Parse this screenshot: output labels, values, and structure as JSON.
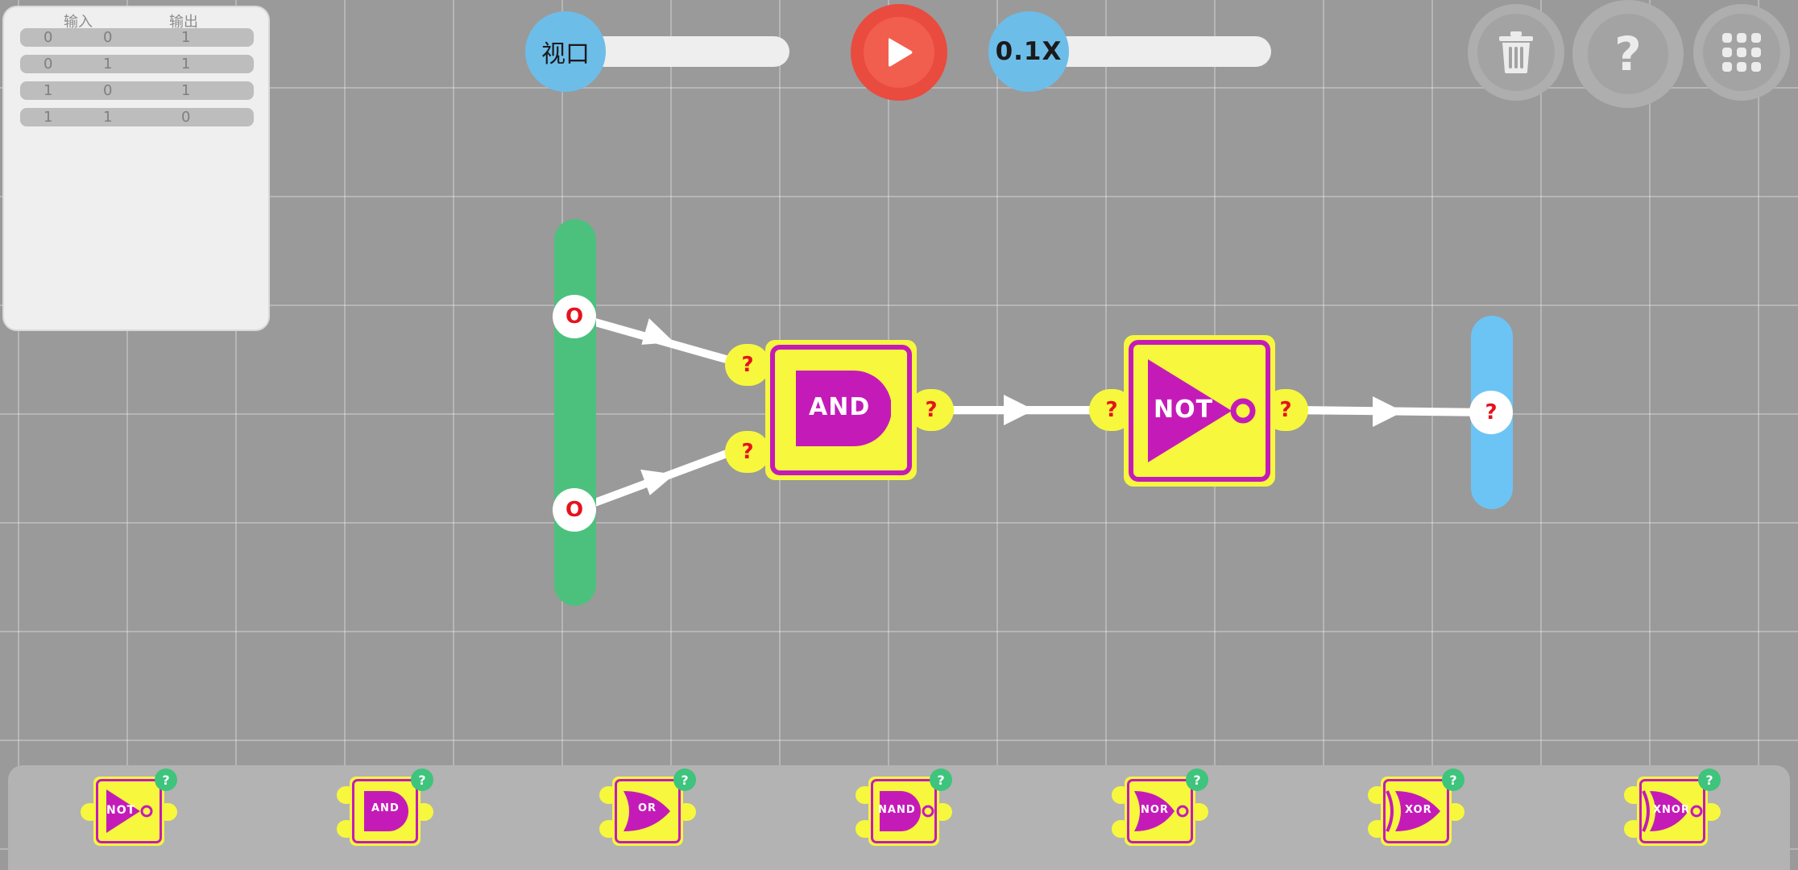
{
  "truth_table": {
    "headers": {
      "input": "输入",
      "output": "输出"
    },
    "rows": [
      [
        "0",
        "0",
        "1"
      ],
      [
        "0",
        "1",
        "1"
      ],
      [
        "1",
        "0",
        "1"
      ],
      [
        "1",
        "1",
        "0"
      ]
    ]
  },
  "controls": {
    "viewport_label": "视口",
    "speed_label": "0.1X",
    "help_label": "?"
  },
  "circuit": {
    "input_pins": [
      "O",
      "O"
    ],
    "and_ports": {
      "in1": "?",
      "in2": "?",
      "out": "?"
    },
    "and_label": "AND",
    "not_ports": {
      "in": "?",
      "out": "?"
    },
    "not_label": "NOT",
    "output_pin": "?"
  },
  "palette": {
    "badge": "?",
    "items": [
      "NOT",
      "AND",
      "OR",
      "NAND",
      "NOR",
      "XOR",
      "XNOR"
    ]
  },
  "colors": {
    "background": "#9a9a9a",
    "gate_yellow": "#f7f73e",
    "gate_magenta": "#c41bb8",
    "input_rail_green": "#4cc17d",
    "output_rail_blue": "#6cc4f5",
    "play_red": "#e94b3f",
    "value_red": "#e5131c",
    "badge_green": "#3ec47c"
  }
}
